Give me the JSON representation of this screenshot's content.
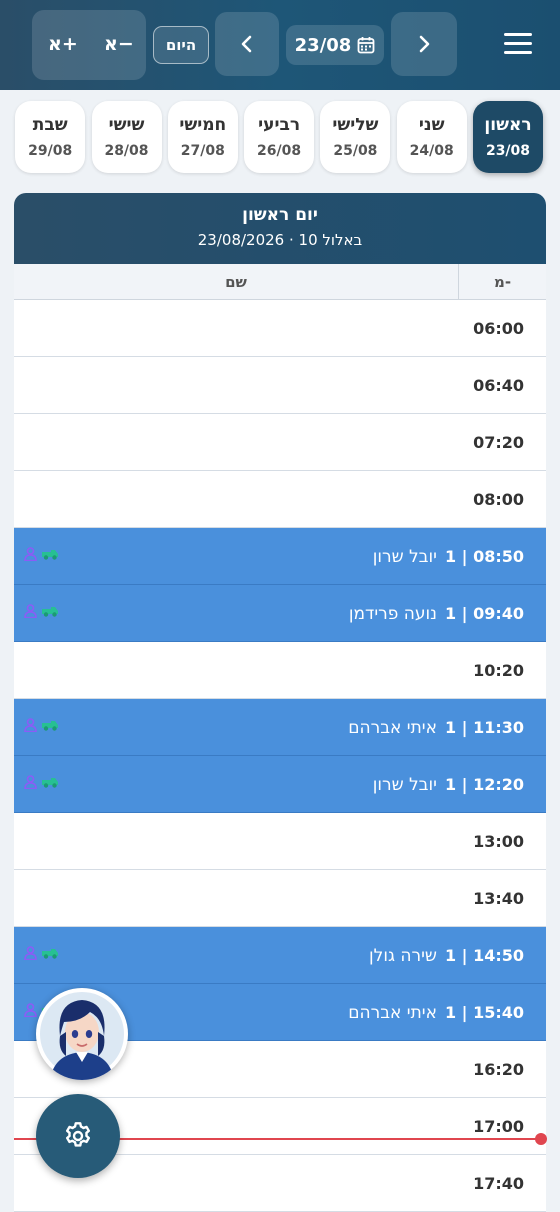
{
  "header": {
    "zoom_plus": "א+",
    "zoom_minus": "א−",
    "today": "היום",
    "date": "23/08"
  },
  "tabs": [
    {
      "name": "ראשון",
      "date": "23/08",
      "active": true
    },
    {
      "name": "שני",
      "date": "24/08"
    },
    {
      "name": "שלישי",
      "date": "25/08"
    },
    {
      "name": "רביעי",
      "date": "26/08"
    },
    {
      "name": "חמישי",
      "date": "27/08"
    },
    {
      "name": "שישי",
      "date": "28/08"
    },
    {
      "name": "שבת",
      "date": "29/08"
    }
  ],
  "schedule": {
    "day_title": "יום ראשון",
    "day_subtitle": "23/08/2026 · 10 באלול",
    "col_from": "מ-",
    "col_name": "שם",
    "rows": [
      {
        "time": "06:00"
      },
      {
        "time": "06:40"
      },
      {
        "time": "07:20"
      },
      {
        "time": "08:00"
      },
      {
        "time": "08:50",
        "count": "1",
        "name": "יובל שרון"
      },
      {
        "time": "09:40",
        "count": "1",
        "name": "נועה פרידמן"
      },
      {
        "time": "10:20"
      },
      {
        "time": "11:30",
        "count": "1",
        "name": "איתי אברהם"
      },
      {
        "time": "12:20",
        "count": "1",
        "name": "יובל שרון"
      },
      {
        "time": "13:00"
      },
      {
        "time": "13:40"
      },
      {
        "time": "14:50",
        "count": "1",
        "name": "שירה גולן"
      },
      {
        "time": "15:40",
        "count": "1",
        "name": "איתי אברהם"
      },
      {
        "time": "16:20"
      },
      {
        "time": "17:00"
      },
      {
        "time": "17:40"
      }
    ]
  },
  "colors": {
    "header": "#1e5677",
    "booked_row": "#4a90dc",
    "now_line": "#e0464f",
    "active_tab": "#1e4a66"
  }
}
